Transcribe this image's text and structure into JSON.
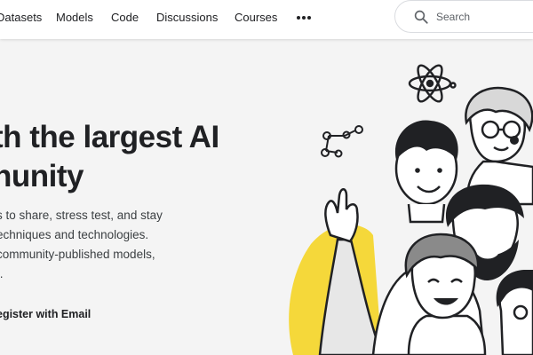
{
  "nav": {
    "items": [
      {
        "label": "Datasets"
      },
      {
        "label": "Models"
      },
      {
        "label": "Code"
      },
      {
        "label": "Discussions"
      },
      {
        "label": "Courses"
      }
    ],
    "more_icon": "more-horizontal-icon"
  },
  "search": {
    "placeholder": "Search",
    "icon": "search-icon"
  },
  "hero": {
    "title_lines": [
      "th the largest AI",
      "nunity"
    ],
    "description_lines": [
      "s to share, stress test, and stay",
      "echniques and technologies.",
      "community-published models,",
      "t."
    ],
    "register_label": "egister with Email"
  },
  "colors": {
    "accent_yellow": "#f5d83a",
    "dark": "#202124"
  }
}
